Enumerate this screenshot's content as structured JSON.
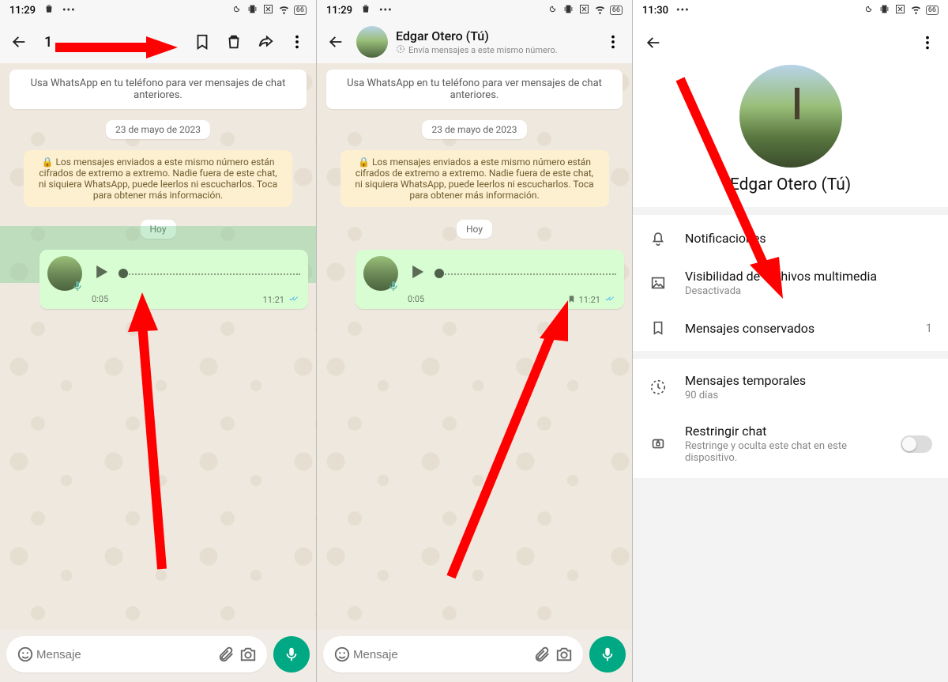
{
  "status": {
    "t1": "11:29",
    "t2": "11:29",
    "t3": "11:30",
    "batt": "66"
  },
  "s1": {
    "selected_count": "1",
    "banner": "Usa WhatsApp en tu teléfono para ver mensajes de chat anteriores.",
    "date": "23 de mayo de 2023",
    "e2e": "🔒 Los mensajes enviados a este mismo número están cifrados de extremo a extremo. Nadie fuera de este chat, ni siquiera WhatsApp, puede leerlos ni escucharlos. Toca para obtener más información.",
    "today": "Hoy",
    "voice": {
      "duration": "0:05",
      "time": "11:21"
    },
    "input_placeholder": "Mensaje"
  },
  "s2": {
    "contact_name": "Edgar Otero (Tú)",
    "contact_sub": "Envía mensajes a este mismo número.",
    "banner": "Usa WhatsApp en tu teléfono para ver mensajes de chat anteriores.",
    "date": "23 de mayo de 2023",
    "e2e": "🔒 Los mensajes enviados a este mismo número están cifrados de extremo a extremo. Nadie fuera de este chat, ni siquiera WhatsApp, puede leerlos ni escucharlos. Toca para obtener más información.",
    "today": "Hoy",
    "voice": {
      "duration": "0:05",
      "time": "11:21"
    },
    "input_placeholder": "Mensaje"
  },
  "s3": {
    "name": "Edgar Otero (Tú)",
    "items": {
      "notif": {
        "title": "Notificaciones"
      },
      "media": {
        "title": "Visibilidad de archivos multimedia",
        "sub": "Desactivada"
      },
      "kept": {
        "title": "Mensajes conservados",
        "count": "1"
      },
      "disap": {
        "title": "Mensajes temporales",
        "sub": "90 días"
      },
      "lock": {
        "title": "Restringir chat",
        "sub": "Restringe y oculta este chat en este dispositivo."
      }
    }
  }
}
